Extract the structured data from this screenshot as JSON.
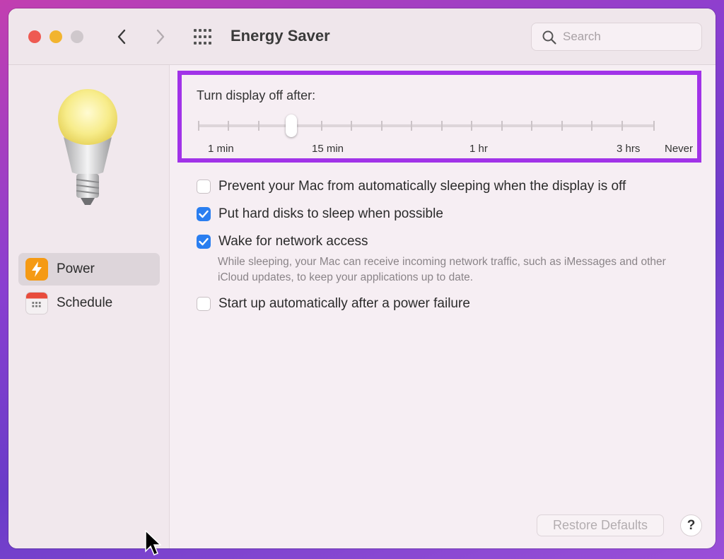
{
  "window": {
    "title": "Energy Saver"
  },
  "search": {
    "placeholder": "Search"
  },
  "sidebar": {
    "items": [
      {
        "label": "Power",
        "icon": "lightning-bolt-icon",
        "selected": true
      },
      {
        "label": "Schedule",
        "icon": "calendar-icon",
        "selected": false
      }
    ]
  },
  "display_sleep": {
    "title": "Turn display off after:",
    "labels": [
      "1 min",
      "15 min",
      "1 hr",
      "3 hrs",
      "Never"
    ],
    "selected": "15 min"
  },
  "options": [
    {
      "label": "Prevent your Mac from automatically sleeping when the display is off",
      "checked": false
    },
    {
      "label": "Put hard disks to sleep when possible",
      "checked": true
    },
    {
      "label": "Wake for network access",
      "checked": true
    },
    {
      "label": "Start up automatically after a power failure",
      "checked": false
    }
  ],
  "wake_description": "While sleeping, your Mac can receive incoming network traffic, such as iMessages and other iCloud updates, to keep your applications up to date.",
  "footer": {
    "restore_label": "Restore Defaults",
    "help_label": "?"
  },
  "colors": {
    "highlight": "#a133e8",
    "checkbox_checked": "#2a7ef0",
    "power_icon": "#f59a14"
  }
}
